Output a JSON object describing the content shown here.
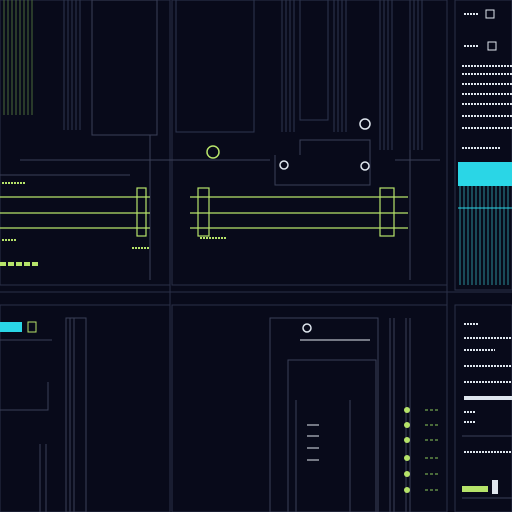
{
  "colors": {
    "background": "#080a1a",
    "panel": "#0b0e22",
    "grid_line": "#2a3048",
    "accent_green": "#b6e36a",
    "accent_cyan": "#2ad6e6",
    "accent_white": "#dfe6ee",
    "dim_white": "#8a93a8"
  },
  "markers": {
    "m1": "",
    "m2": "",
    "m3": "",
    "m4": "",
    "m5": ""
  }
}
